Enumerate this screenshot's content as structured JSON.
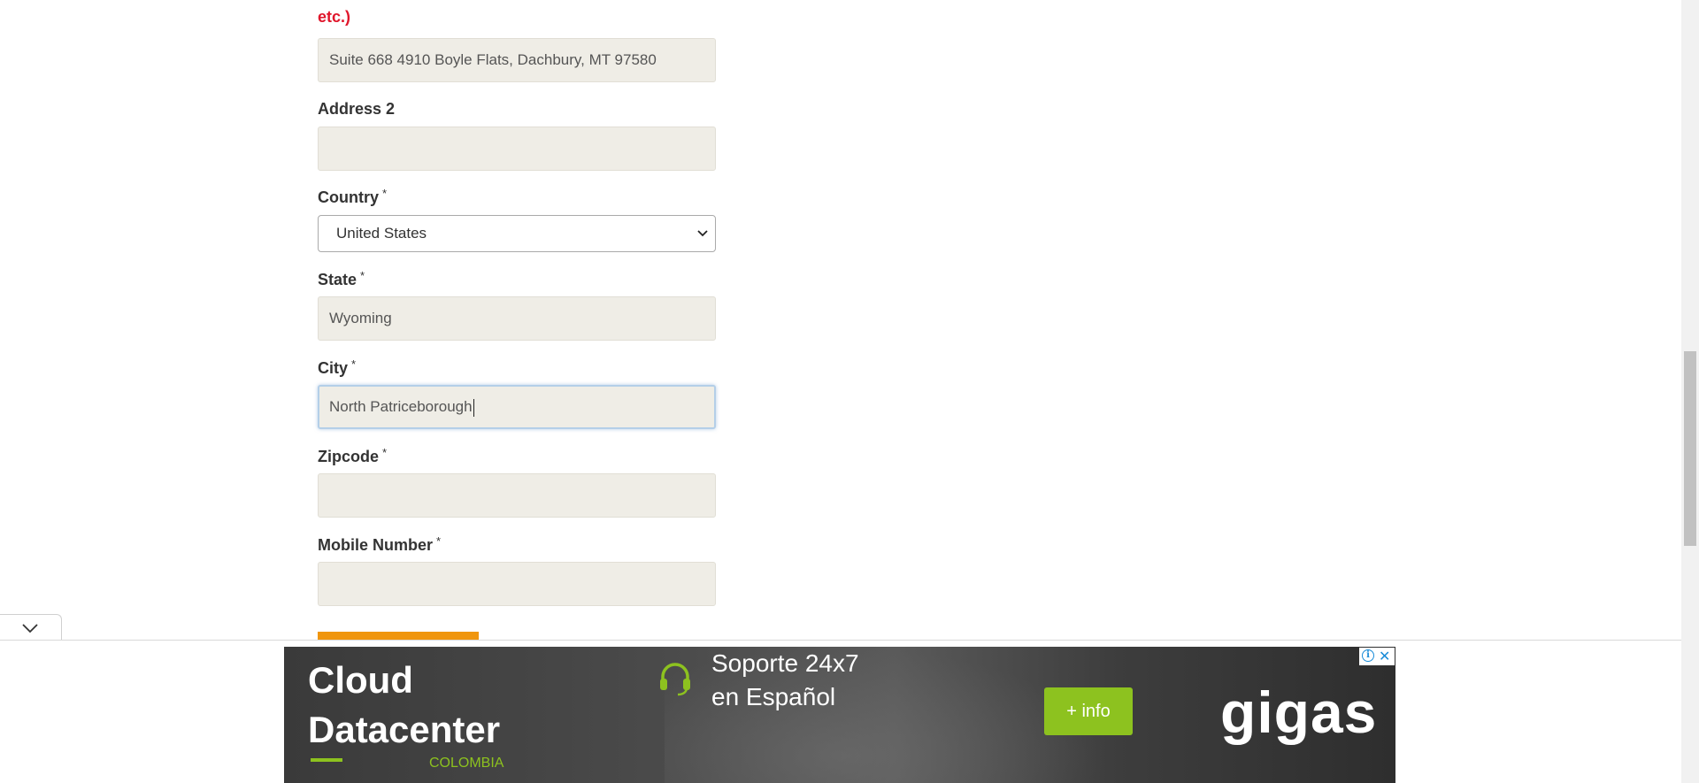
{
  "form": {
    "address_note": "etc.)",
    "address1": {
      "value": "Suite 668 4910 Boyle Flats, Dachbury, MT 97580"
    },
    "address2": {
      "label": "Address 2",
      "value": ""
    },
    "country": {
      "label": "Country",
      "required": "*",
      "value": "United States"
    },
    "state": {
      "label": "State",
      "required": "*",
      "value": "Wyoming"
    },
    "city": {
      "label": "City",
      "required": "*",
      "value": "North Patriceborough"
    },
    "zipcode": {
      "label": "Zipcode",
      "required": "*",
      "value": ""
    },
    "mobile": {
      "label": "Mobile Number",
      "required": "*",
      "value": ""
    }
  },
  "ad": {
    "title_line1": "Cloud",
    "title_line2": "Datacenter",
    "country": "COLOMBIA",
    "support_line1": "Soporte 24x7",
    "support_line2": "en Español",
    "button": "+ info",
    "brand": "gigas",
    "choices_icon": "i",
    "close_icon": "✕"
  },
  "colors": {
    "accent_red": "#e0162b",
    "button_orange": "#f0960e",
    "ad_green": "#8dc21f",
    "field_bg": "#efede6"
  },
  "icons": {
    "collapse": "chevron-down-icon",
    "select": "chevron-down-icon",
    "headset": "headset-icon",
    "adchoices": "info-icon",
    "close": "close-icon"
  }
}
